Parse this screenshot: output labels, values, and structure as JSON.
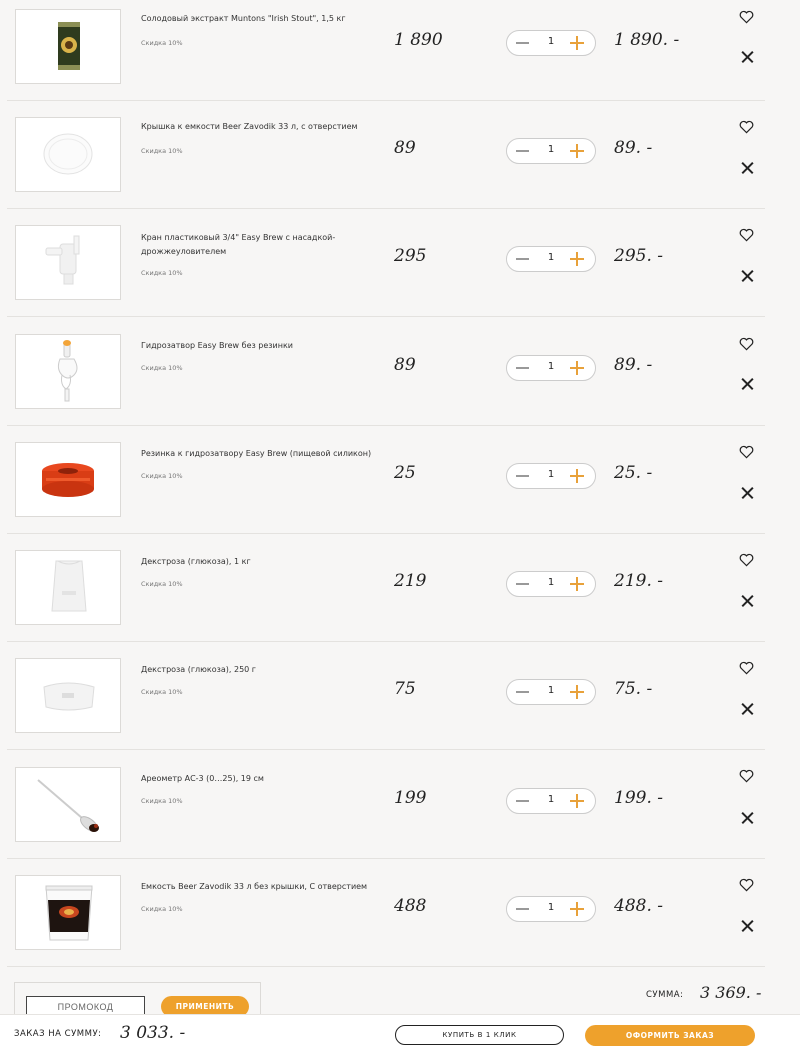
{
  "cart": {
    "items": [
      {
        "name": "Солодовый экстракт Muntons \"Irish Stout\", 1,5 кг",
        "discount": "Скидка 10%",
        "price": "1 890",
        "qty": "1",
        "total": "1 890. -",
        "image": "malt-extract-can"
      },
      {
        "name": "Крышка к емкости Beer Zavodik 33 л, с отверстием",
        "discount": "Скидка 10%",
        "price": "89",
        "qty": "1",
        "total": "89. -",
        "image": "bucket-lid"
      },
      {
        "name": "Кран пластиковый 3/4\" Easy Brew с насадкой-дрожжеуловителем",
        "discount": "Скидка 10%",
        "price": "295",
        "qty": "1",
        "total": "295. -",
        "image": "plastic-tap"
      },
      {
        "name": "Гидрозатвор Easy Brew без резинки",
        "discount": "Скидка 10%",
        "price": "89",
        "qty": "1",
        "total": "89. -",
        "image": "airlock"
      },
      {
        "name": "Резинка к гидрозатвору Easy Brew (пищевой силикон)",
        "discount": "Скидка 10%",
        "price": "25",
        "qty": "1",
        "total": "25. -",
        "image": "silicone-grommet"
      },
      {
        "name": "Декстроза (глюкоза), 1 кг",
        "discount": "Скидка 10%",
        "price": "219",
        "qty": "1",
        "total": "219. -",
        "image": "dextrose-bag-1kg"
      },
      {
        "name": "Декстроза (глюкоза), 250 г",
        "discount": "Скидка 10%",
        "price": "75",
        "qty": "1",
        "total": "75. -",
        "image": "dextrose-bag-250g"
      },
      {
        "name": "Ареометр АС-3 (0…25), 19 см",
        "discount": "Скидка 10%",
        "price": "199",
        "qty": "1",
        "total": "199. -",
        "image": "hydrometer"
      },
      {
        "name": "Емкость Beer Zavodik 33 л без крышки, С отверстием",
        "discount": "Скидка 10%",
        "price": "488",
        "qty": "1",
        "total": "488. -",
        "image": "fermenter-bucket"
      }
    ]
  },
  "promo": {
    "placeholder": "ПРОМОКОД",
    "apply_label": "ПРИМЕНИТЬ"
  },
  "summary": {
    "sum_label": "СУММА:",
    "sum_value": "3 369. -"
  },
  "bottom_bar": {
    "order_label": "ЗАКАЗ НА СУММУ:",
    "order_value": "3 033. -",
    "one_click_label": "КУПИТЬ В 1 КЛИК",
    "checkout_label": "ОФОРМИТЬ ЗАКАЗ"
  },
  "colors": {
    "accent": "#eea12c",
    "background": "#f7f6f5"
  }
}
